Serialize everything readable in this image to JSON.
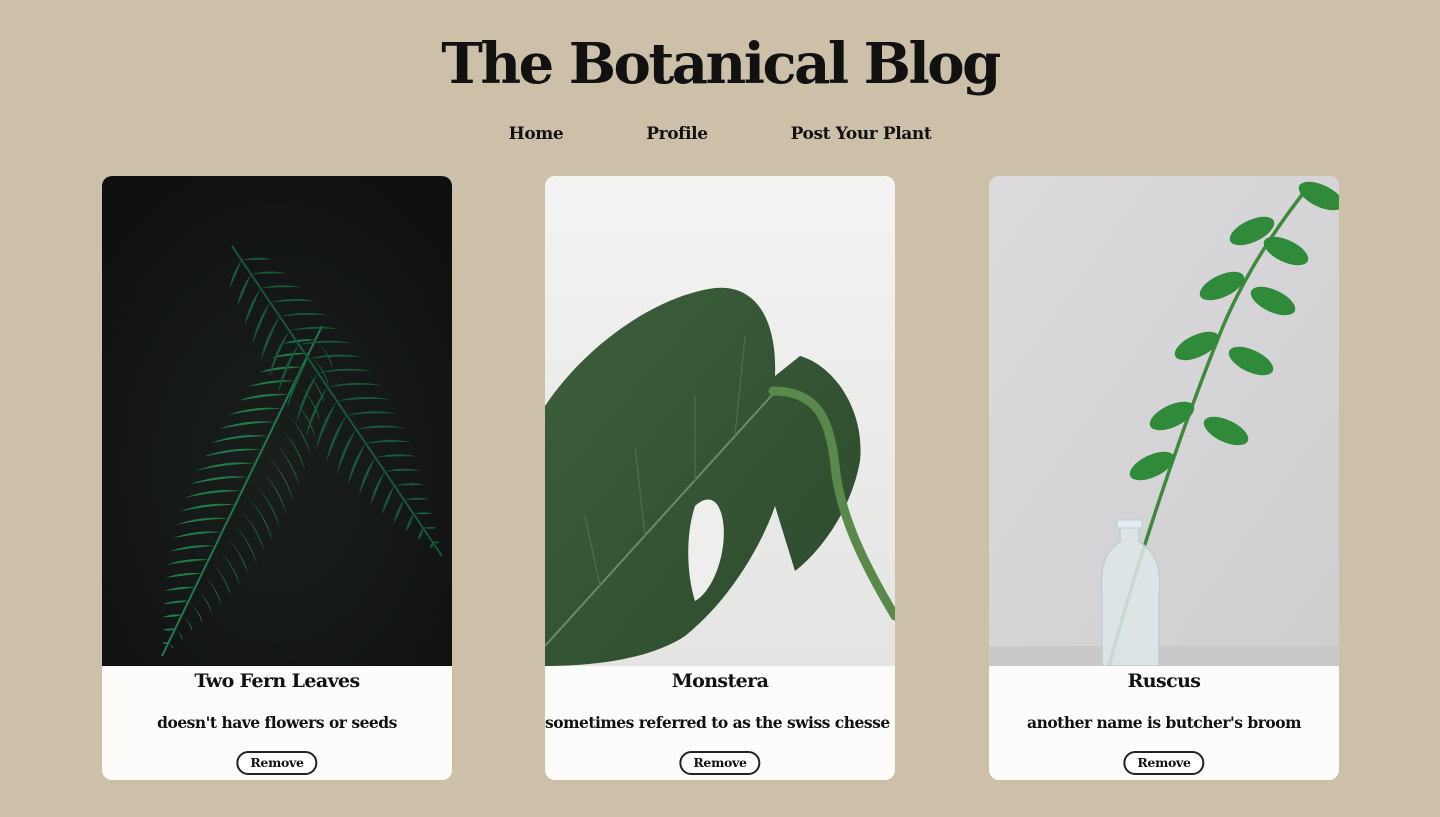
{
  "site": {
    "title": "The Botanical Blog"
  },
  "nav": {
    "items": [
      "Home",
      "Profile",
      "Post Your Plant"
    ]
  },
  "posts": [
    {
      "title": "Two Fern Leaves",
      "description": "doesn't have flowers or seeds",
      "remove_label": "Remove",
      "photo_icon": "fern-photo"
    },
    {
      "title": "Monstera",
      "description": "sometimes referred to as the swiss chesse plant",
      "remove_label": "Remove",
      "photo_icon": "monstera-photo"
    },
    {
      "title": "Ruscus",
      "description": "another name is butcher's broom",
      "remove_label": "Remove",
      "photo_icon": "ruscus-photo"
    }
  ],
  "colors": {
    "background": "#cdc0a9",
    "card": "#fefcfa",
    "leaf_green": "#1f6b45"
  }
}
